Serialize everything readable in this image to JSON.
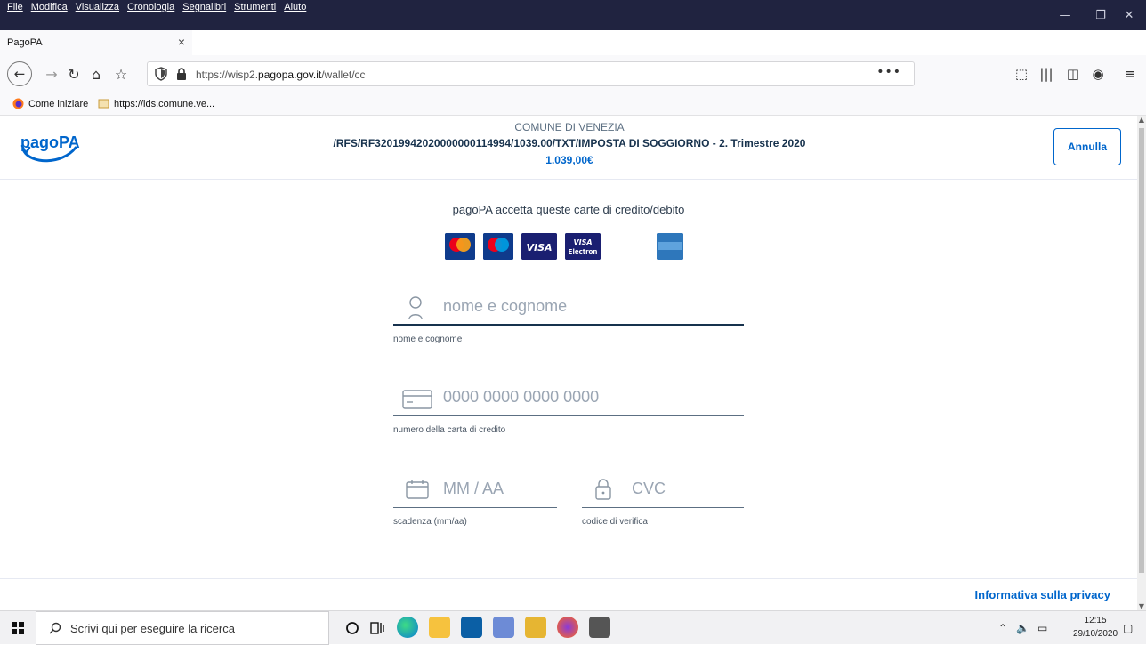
{
  "menubar": [
    "File",
    "Modifica",
    "Visualizza",
    "Cronologia",
    "Segnalibri",
    "Strumenti",
    "Aiuto"
  ],
  "tab": {
    "title": "PagoPA"
  },
  "url": {
    "prefix": "https://wisp2.",
    "domain": "pagopa.gov.it",
    "path": "/wallet/cc"
  },
  "bookmarks": [
    {
      "label": "Come iniziare",
      "icon": "firefox-icon"
    },
    {
      "label": "https://ids.comune.ve...",
      "icon": "page-icon"
    }
  ],
  "header": {
    "logo_text": "pagoPA",
    "merchant": "COMUNE DI VENEZIA",
    "description": "/RFS/RF32019942020000000114994/1039.00/TXT/IMPOSTA DI SOGGIORNO - 2. Trimestre 2020",
    "amount": "1.039,00€",
    "cancel_label": "Annulla"
  },
  "cards": {
    "title": "pagoPA accetta queste carte di credito/debito",
    "list": [
      "mastercard",
      "maestro",
      "VISA",
      "VISA Electron",
      "AMERICAN EXPRESS"
    ]
  },
  "form": {
    "name_placeholder": "nome e cognome",
    "name_label": "nome e cognome",
    "card_placeholder": "0000 0000 0000 0000",
    "card_label": "numero della carta di credito",
    "expiry_placeholder": "MM / AA",
    "expiry_label": "scadenza (mm/aa)",
    "cvc_placeholder": "CVC",
    "cvc_label": "codice di verifica"
  },
  "footer": {
    "privacy": "Informativa sulla privacy"
  },
  "taskbar": {
    "search_placeholder": "Scrivi qui per eseguire la ricerca",
    "time": "12:15",
    "date": "29/10/2020"
  },
  "colors": {
    "brand": "#0066cc",
    "titlebar": "#202340",
    "text_dark": "#17324d"
  }
}
